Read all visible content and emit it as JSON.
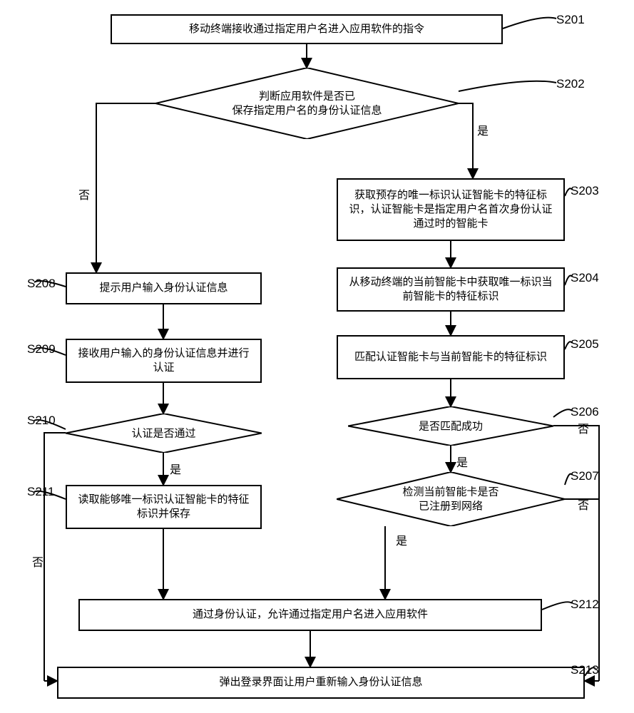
{
  "chart_data": {
    "type": "flowchart",
    "nodes": [
      {
        "id": "S201",
        "shape": "rect",
        "text": "移动终端接收通过指定用户名进入应用软件的指令"
      },
      {
        "id": "S202",
        "shape": "diamond",
        "text": "判断应用软件是否已保存指定用户名的身份认证信息"
      },
      {
        "id": "S203",
        "shape": "rect",
        "text": "获取预存的唯一标识认证智能卡的特征标识，认证智能卡是指定用户名首次身份认证通过时的智能卡"
      },
      {
        "id": "S204",
        "shape": "rect",
        "text": "从移动终端的当前智能卡中获取唯一标识当前智能卡的特征标识"
      },
      {
        "id": "S205",
        "shape": "rect",
        "text": "匹配认证智能卡与当前智能卡的特征标识"
      },
      {
        "id": "S206",
        "shape": "diamond",
        "text": "是否匹配成功"
      },
      {
        "id": "S207",
        "shape": "diamond",
        "text": "检测当前智能卡是否已注册到网络"
      },
      {
        "id": "S208",
        "shape": "rect",
        "text": "提示用户输入身份认证信息"
      },
      {
        "id": "S209",
        "shape": "rect",
        "text": "接收用户输入的身份认证信息并进行认证"
      },
      {
        "id": "S210",
        "shape": "diamond",
        "text": "认证是否通过"
      },
      {
        "id": "S211",
        "shape": "rect",
        "text": "读取能够唯一标识认证智能卡的特征标识并保存"
      },
      {
        "id": "S212",
        "shape": "rect",
        "text": "通过身份认证，允许通过指定用户名进入应用软件"
      },
      {
        "id": "S213",
        "shape": "rect",
        "text": "弹出登录界面让用户重新输入身份认证信息"
      }
    ],
    "edges": [
      {
        "from": "S201",
        "to": "S202"
      },
      {
        "from": "S202",
        "to": "S203",
        "label": "是"
      },
      {
        "from": "S202",
        "to": "S208",
        "label": "否"
      },
      {
        "from": "S203",
        "to": "S204"
      },
      {
        "from": "S204",
        "to": "S205"
      },
      {
        "from": "S205",
        "to": "S206"
      },
      {
        "from": "S206",
        "to": "S207",
        "label": "是"
      },
      {
        "from": "S206",
        "to": "S213",
        "label": "否"
      },
      {
        "from": "S207",
        "to": "S212",
        "label": "是"
      },
      {
        "from": "S207",
        "to": "S213",
        "label": "否"
      },
      {
        "from": "S208",
        "to": "S209"
      },
      {
        "from": "S209",
        "to": "S210"
      },
      {
        "from": "S210",
        "to": "S211",
        "label": "是"
      },
      {
        "from": "S210",
        "to": "S213",
        "label": "否"
      },
      {
        "from": "S211",
        "to": "S212"
      },
      {
        "from": "S212",
        "to": "S213"
      }
    ]
  },
  "steps": {
    "s201": {
      "label": "S201",
      "text": "移动终端接收通过指定用户名进入应用软件的指令"
    },
    "s202": {
      "label": "S202",
      "line1": "判断应用软件是否已",
      "line2": "保存指定用户名的身份认证信息"
    },
    "s203": {
      "label": "S203",
      "text": "获取预存的唯一标识认证智能卡的特征标识，认证智能卡是指定用户名首次身份认证通过时的智能卡"
    },
    "s204": {
      "label": "S204",
      "text": "从移动终端的当前智能卡中获取唯一标识当前智能卡的特征标识"
    },
    "s205": {
      "label": "S205",
      "text": "匹配认证智能卡与当前智能卡的特征标识"
    },
    "s206": {
      "label": "S206",
      "text": "是否匹配成功"
    },
    "s207": {
      "label": "S207",
      "line1": "检测当前智能卡是否",
      "line2": "已注册到网络"
    },
    "s208": {
      "label": "S208",
      "text": "提示用户输入身份认证信息"
    },
    "s209": {
      "label": "S209",
      "text": "接收用户输入的身份认证信息并进行认证"
    },
    "s210": {
      "label": "S210",
      "text": "认证是否通过"
    },
    "s211": {
      "label": "S211",
      "text": "读取能够唯一标识认证智能卡的特征标识并保存"
    },
    "s212": {
      "label": "S212",
      "text": "通过身份认证，允许通过指定用户名进入应用软件"
    },
    "s213": {
      "label": "S213",
      "text": "弹出登录界面让用户重新输入身份认证信息"
    }
  },
  "branch": {
    "yes": "是",
    "no": "否"
  }
}
